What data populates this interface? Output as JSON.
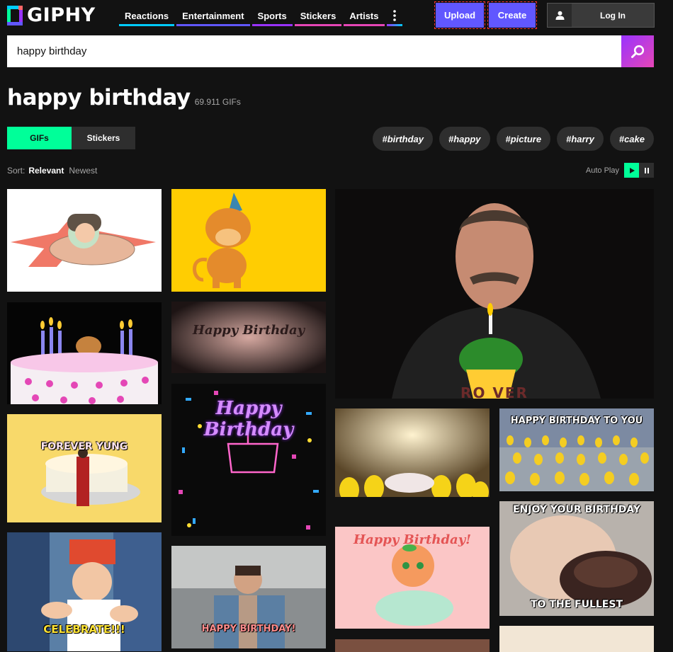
{
  "header": {
    "logo_text": "GIPHY",
    "nav": [
      {
        "label": "Reactions",
        "color": "#00ccff"
      },
      {
        "label": "Entertainment",
        "color": "#6157ff"
      },
      {
        "label": "Sports",
        "color": "#9933ff"
      },
      {
        "label": "Stickers",
        "color": "#e646b6"
      },
      {
        "label": "Artists",
        "color": "#e646b6"
      }
    ],
    "more_icon": "more-vertical-icon",
    "upload_label": "Upload",
    "create_label": "Create",
    "login_label": "Log In"
  },
  "search": {
    "value": "happy birthday",
    "icon": "search-icon"
  },
  "results": {
    "title": "happy birthday",
    "count": "69.911 GIFs"
  },
  "tabs": [
    {
      "label": "GIFs",
      "active": true
    },
    {
      "label": "Stickers",
      "active": false
    }
  ],
  "tags": [
    "#birthday",
    "#happy",
    "#picture",
    "#harry",
    "#cake"
  ],
  "sort": {
    "label": "Sort:",
    "options": [
      "Relevant",
      "Newest"
    ],
    "selected": "Relevant"
  },
  "autoplay": {
    "label": "Auto Play",
    "play_icon": "play-icon",
    "pause_icon": "pause-icon"
  },
  "gifs": [
    {
      "id": "cartoon-boy-cross",
      "caption": ""
    },
    {
      "id": "monkey-party-hat",
      "caption": ""
    },
    {
      "id": "man-candle-cupcake",
      "caption": "RO    VER"
    },
    {
      "id": "birthday-cake-mouse",
      "caption": ""
    },
    {
      "id": "happy-birthday-sparkle",
      "caption": "Happy Birthday"
    },
    {
      "id": "forever-young-cake",
      "caption": "FOREVER YUNG"
    },
    {
      "id": "neon-happy-birthday",
      "caption": "Happy Birthday"
    },
    {
      "id": "minions-party",
      "caption": ""
    },
    {
      "id": "minions-crowd",
      "caption": "HAPPY BIRTHDAY TO YOU"
    },
    {
      "id": "peach-happy-birthday",
      "caption": "Happy Birthday!"
    },
    {
      "id": "kid-celebrate",
      "caption": "CELEBRATE!!!"
    },
    {
      "id": "man-confetti",
      "caption": "HAPPY BIRTHDAY!"
    },
    {
      "id": "baby-cake",
      "caption_top": "ENJOY YOUR BIRTHDAY",
      "caption_bottom": "TO THE FULLEST"
    }
  ]
}
